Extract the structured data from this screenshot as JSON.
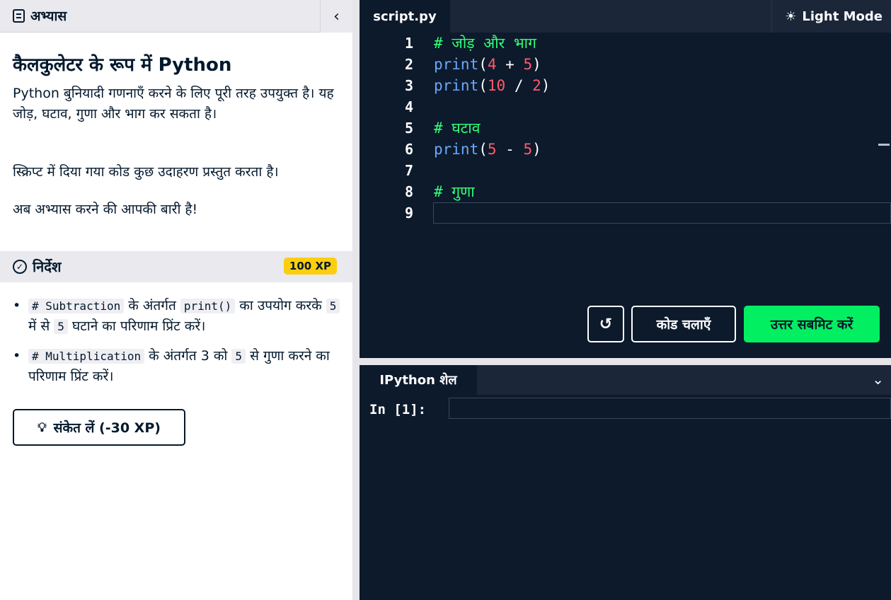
{
  "left": {
    "tag": "अभ्यास",
    "collapse": "‹",
    "title": "कैलकुलेटर के रूप में Python",
    "paragraphs": [
      "Python बुनियादी गणनाएँ करने के लिए पूरी तरह उपयुक्त है। यह जोड़, घटाव, गुणा और भाग कर सकता है।",
      "स्क्रिप्ट में दिया गया कोड कुछ उदाहरण प्रस्तुत करता है।",
      "अब अभ्यास करने की आपकी बारी है!"
    ],
    "instructions_title": "निर्देश",
    "xp": "100 XP",
    "instructions": [
      {
        "code1": "# Subtraction",
        "t1": " के अंतर्गत ",
        "code2": "print()",
        "t2": " का उपयोग करके ",
        "code3": "5",
        "t3": " में से ",
        "code4": "5",
        "t4": " घटाने का परिणाम प्रिंट करें।"
      },
      {
        "code1": "# Multiplication",
        "t1": " के अंतर्गत 3 को ",
        "code2": "5",
        "t2": " से गुणा करने का परिणाम प्रिंट करें।"
      }
    ],
    "hint": "संकेत लें (-30 XP)"
  },
  "editor": {
    "tab": "script.py",
    "mode": "Light Mode",
    "lines": [
      {
        "n": "1",
        "parts": [
          {
            "t": "# जोड़ और भाग",
            "c": "c-comment"
          }
        ]
      },
      {
        "n": "2",
        "parts": [
          {
            "t": "print",
            "c": "c-kw"
          },
          {
            "t": "(",
            "c": "c-op"
          },
          {
            "t": "4",
            "c": "c-num"
          },
          {
            "t": " + ",
            "c": "c-op"
          },
          {
            "t": "5",
            "c": "c-num"
          },
          {
            "t": ")",
            "c": "c-op"
          }
        ]
      },
      {
        "n": "3",
        "parts": [
          {
            "t": "print",
            "c": "c-kw"
          },
          {
            "t": "(",
            "c": "c-op"
          },
          {
            "t": "10",
            "c": "c-num"
          },
          {
            "t": " / ",
            "c": "c-op"
          },
          {
            "t": "2",
            "c": "c-num"
          },
          {
            "t": ")",
            "c": "c-op"
          }
        ]
      },
      {
        "n": "4",
        "parts": []
      },
      {
        "n": "5",
        "parts": [
          {
            "t": "# घटाव",
            "c": "c-comment"
          }
        ]
      },
      {
        "n": "6",
        "parts": [
          {
            "t": "print",
            "c": "c-kw"
          },
          {
            "t": "(",
            "c": "c-op"
          },
          {
            "t": "5",
            "c": "c-num"
          },
          {
            "t": " - ",
            "c": "c-op"
          },
          {
            "t": "5",
            "c": "c-num"
          },
          {
            "t": ")",
            "c": "c-op"
          }
        ]
      },
      {
        "n": "7",
        "parts": []
      },
      {
        "n": "8",
        "parts": [
          {
            "t": "# गुणा",
            "c": "c-comment"
          }
        ]
      },
      {
        "n": "9",
        "parts": [],
        "active": true
      }
    ],
    "reset_icon": "↺",
    "run": "कोड चलाएँ",
    "submit": "उत्तर सबमिट करें"
  },
  "shell": {
    "tab": "IPython शेल",
    "chevron": "⌄",
    "prompt": "In [1]:"
  },
  "colors": {
    "accent": "#03ef62",
    "editor_bg": "#0d1a2b",
    "xp_badge": "#fcce0d"
  }
}
